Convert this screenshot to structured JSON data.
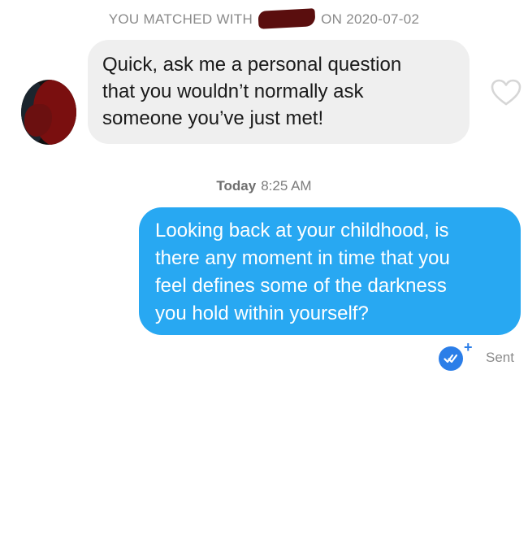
{
  "header": {
    "prefix": "YOU MATCHED WITH",
    "name_tail": "ON 2020-07-02"
  },
  "messages": {
    "received": {
      "lines": [
        "Quick, ask me a personal question",
        "that you wouldn’t normally ask",
        "someone you’ve just met!"
      ]
    },
    "timestamp": {
      "day": "Today",
      "time": "8:25 AM"
    },
    "sent": {
      "lines": [
        "Looking back at your childhood, is",
        "there any moment in time that you",
        "feel defines some of the darkness",
        "you hold within yourself?"
      ],
      "status": "Sent",
      "status_badge_plus": "+"
    }
  },
  "icons": {
    "like": "heart-outline-icon",
    "read_receipt": "double-check-icon"
  },
  "colors": {
    "sent_bubble": "#28a8f2",
    "received_bubble": "#efefef",
    "badge": "#2b7ee8",
    "muted_text": "#8a8a8a"
  }
}
